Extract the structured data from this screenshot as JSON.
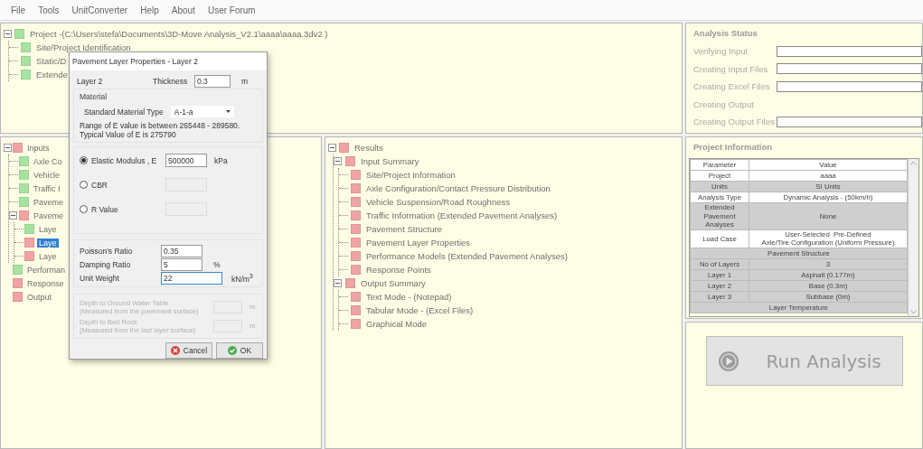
{
  "menu": [
    "File",
    "Tools",
    "UnitConverter",
    "Help",
    "About",
    "User Forum"
  ],
  "project_tree": [
    {
      "label": "Project -(C:\\Users\\stefa\\Documents\\3D-Move Analysis_V2.1\\aaaa\\aaaa.3dv2 )",
      "color": "#a6e3a0",
      "selected": false,
      "expanded": true,
      "children": [
        {
          "label": "Site/Project Identification",
          "color": "#a6e3a0",
          "selected": false
        },
        {
          "label": "Static/D",
          "color": "#a6e3a0",
          "selected": false
        },
        {
          "label": "Extende",
          "color": "#a6e3a0",
          "selected": false
        }
      ]
    }
  ],
  "inputs_tree": [
    {
      "label": "Inputs",
      "color": "#f0a3a3",
      "selected": false,
      "expanded": true,
      "children": [
        {
          "label": "Axle Co",
          "color": "#a6e3a0",
          "selected": false
        },
        {
          "label": "Vehicle",
          "color": "#a6e3a0",
          "selected": false
        },
        {
          "label": "Traffic I",
          "color": "#a6e3a0",
          "selected": false
        },
        {
          "label": "Paveme",
          "color": "#a6e3a0",
          "selected": false
        },
        {
          "label": "Paveme",
          "color": "#f0a3a3",
          "selected": false,
          "expanded": true,
          "children": [
            {
              "label": "Laye",
              "color": "#a6e3a0",
              "selected": false
            },
            {
              "label": "Laye",
              "color": "#f0a3a3",
              "selected": true
            },
            {
              "label": "Laye",
              "color": "#f0a3a3",
              "selected": false
            }
          ]
        }
      ]
    },
    {
      "label": "Performan",
      "color": "#a6e3a0",
      "selected": false
    },
    {
      "label": "Response",
      "color": "#f0a3a3",
      "selected": false
    },
    {
      "label": "Output",
      "color": "#f0a3a3",
      "selected": false
    }
  ],
  "results_tree": [
    {
      "label": "Results",
      "color": "#f0a3a3",
      "selected": false,
      "expanded": true,
      "children": [
        {
          "label": "Input Summary",
          "color": "#f0a3a3",
          "selected": false,
          "expanded": true,
          "children": [
            {
              "label": "Site/Project Information",
              "color": "#f0a3a3",
              "selected": false
            },
            {
              "label": "Axle Configuration/Contact Pressure Distribution",
              "color": "#f0a3a3",
              "selected": false
            },
            {
              "label": "Vehicle Suspension/Road Roughness",
              "color": "#f0a3a3",
              "selected": false
            },
            {
              "label": "Traffic Information (Extended Pavement Analyses)",
              "color": "#f0a3a3",
              "selected": false
            },
            {
              "label": "Pavement Structure",
              "color": "#f0a3a3",
              "selected": false
            },
            {
              "label": "Pavement Layer Properties",
              "color": "#f0a3a3",
              "selected": false
            },
            {
              "label": "Performance Models (Extended Pavement Analyses)",
              "color": "#f0a3a3",
              "selected": false
            },
            {
              "label": "Response Points",
              "color": "#f0a3a3",
              "selected": false
            }
          ]
        },
        {
          "label": "Output Summary",
          "color": "#f0a3a3",
          "selected": false,
          "expanded": true,
          "children": [
            {
              "label": "Text Mode - (Notepad)",
              "color": "#f0a3a3",
              "selected": false
            },
            {
              "label": "Tabular Mode - (Excel Files)",
              "color": "#f0a3a3",
              "selected": false
            },
            {
              "label": "Graphical Mode",
              "color": "#f0a3a3",
              "selected": false
            }
          ]
        }
      ]
    }
  ],
  "analysis_status": {
    "title": "Analysis Status",
    "steps": [
      {
        "label": "Verifying Input",
        "kind": "bar"
      },
      {
        "label": "Creating Input Files",
        "kind": "bar"
      },
      {
        "label": "Creating Excel Files",
        "kind": "bar"
      },
      {
        "label": "Creating Output",
        "kind": "plain"
      },
      {
        "label": "Creating Output Files",
        "kind": "bar"
      }
    ]
  },
  "project_information": {
    "title": "Project Information",
    "columns": [
      "Parameter",
      "Value"
    ],
    "rows": [
      {
        "kind": "row",
        "cells": [
          "Project",
          "aaaa"
        ],
        "shaded": false
      },
      {
        "kind": "row",
        "cells": [
          "Units",
          "SI Units"
        ],
        "shaded": true
      },
      {
        "kind": "row",
        "cells": [
          "Analysis Type",
          "Dynamic Analysis - (50km/h)"
        ],
        "shaded": false
      },
      {
        "kind": "row",
        "cells": [
          "Extended\nPavement\nAnalyses",
          "None"
        ],
        "shaded": true
      },
      {
        "kind": "row",
        "cells": [
          "Load Case",
          "User-Selected  Pre-Defined\nAxle/Tire Configuration (Uniform Pressure)"
        ],
        "shaded": false
      },
      {
        "kind": "section",
        "label": "Pavement Structure",
        "shaded": true
      },
      {
        "kind": "row",
        "cells": [
          "No of Layers",
          "3"
        ],
        "shaded": true
      },
      {
        "kind": "row",
        "cells": [
          "Layer 1",
          "Asphalt (0.177m)"
        ],
        "shaded": true
      },
      {
        "kind": "row",
        "cells": [
          "Layer 2",
          "Base (0.3m)"
        ],
        "shaded": true
      },
      {
        "kind": "row",
        "cells": [
          "Layer 3",
          "Subbase (0m)"
        ],
        "shaded": true
      },
      {
        "kind": "section",
        "label": "Layer Temperature",
        "shaded": true
      }
    ]
  },
  "run_button": {
    "label": "Run Analysis",
    "disabled": true
  },
  "dialog": {
    "title": "Pavement Layer Properties - Layer 2",
    "layer_label": "Layer 2",
    "thickness": {
      "label": "Thickness",
      "value": "0.3",
      "unit": "m"
    },
    "material": {
      "legend": "Material",
      "type_label": "Standard Material Type",
      "type_value": "A-1-a",
      "notes": [
        "Range of E value is between 265448 - 289580.",
        "Typical Value of E is 275790"
      ]
    },
    "modulus_options": [
      {
        "label": "Elastic  Modulus , E",
        "selected": true,
        "value": "500000",
        "unit": "kPa"
      },
      {
        "label": "CBR",
        "selected": false
      },
      {
        "label": "R Value",
        "selected": false
      }
    ],
    "properties": [
      {
        "label": "Poisson's Ratio",
        "value": "0.35",
        "focused": false
      },
      {
        "label": "Damping Ratio",
        "value": "5",
        "unit": "%",
        "focused": false
      },
      {
        "label": "Unit Weight",
        "value": "22",
        "unit": "kN/m$^{3}$",
        "focused": true
      }
    ],
    "depths": {
      "disabled": true,
      "items": [
        {
          "label": "Depth to Ground Water Table",
          "note": "(Measured from the pavement surface)",
          "unit": "m"
        },
        {
          "label": "Depth to Bed Rock",
          "note": "(Measured from the last layer surface)",
          "unit": "m"
        }
      ]
    },
    "buttons": [
      {
        "label": "Cancel",
        "kind": "cancel"
      },
      {
        "label": "OK",
        "kind": "ok"
      }
    ]
  }
}
